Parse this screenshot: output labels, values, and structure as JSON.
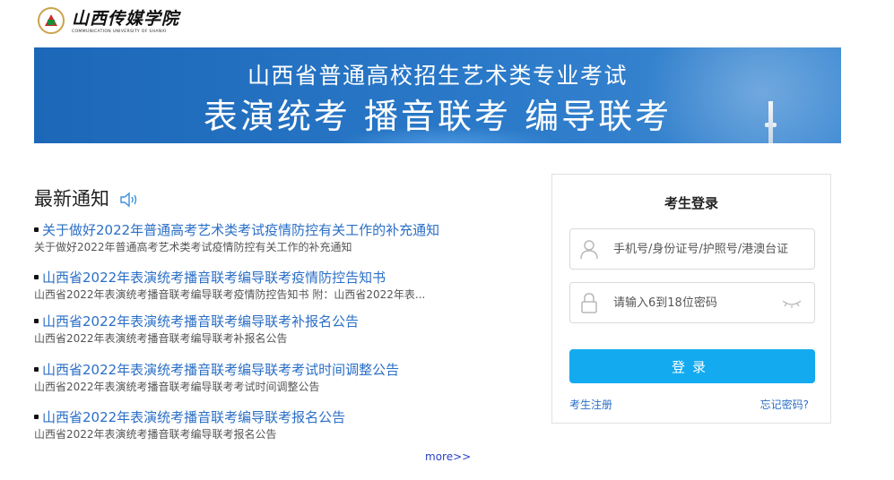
{
  "header": {
    "logo_name": "山西传媒学院",
    "logo_sub": "COMMUNICATION UNIVERSITY OF SHANXI"
  },
  "banner": {
    "line1": "山西省普通高校招生艺术类专业考试",
    "line2": "表演统考 播音联考 编导联考"
  },
  "news": {
    "title": "最新通知",
    "items": [
      {
        "title": "关于做好2022年普通高考艺术类考试疫情防控有关工作的补充通知",
        "summary": "关于做好2022年普通高考艺术类考试疫情防控有关工作的补充通知"
      },
      {
        "title": "山西省2022年表演统考播音联考编导联考疫情防控告知书",
        "summary": "山西省2022年表演统考播音联考编导联考疫情防控告知书 附：山西省2022年表..."
      },
      {
        "title": "山西省2022年表演统考播音联考编导联考补报名公告",
        "summary": "山西省2022年表演统考播音联考编导联考补报名公告"
      },
      {
        "title": "山西省2022年表演统考播音联考编导联考考试时间调整公告",
        "summary": "山西省2022年表演统考播音联考编导联考考试时间调整公告"
      },
      {
        "title": "山西省2022年表演统考播音联考编导联考报名公告",
        "summary": "山西省2022年表演统考播音联考编导联考报名公告"
      }
    ],
    "more": "more>>"
  },
  "login": {
    "title": "考生登录",
    "id_placeholder": "手机号/身份证号/护照号/港澳台证",
    "pwd_placeholder": "请输入6到18位密码",
    "submit": "登录",
    "register": "考生注册",
    "forgot": "忘记密码?"
  },
  "colors": {
    "accent": "#13aaf0",
    "link": "#2b6fc6",
    "banner": "#2a79c8"
  }
}
